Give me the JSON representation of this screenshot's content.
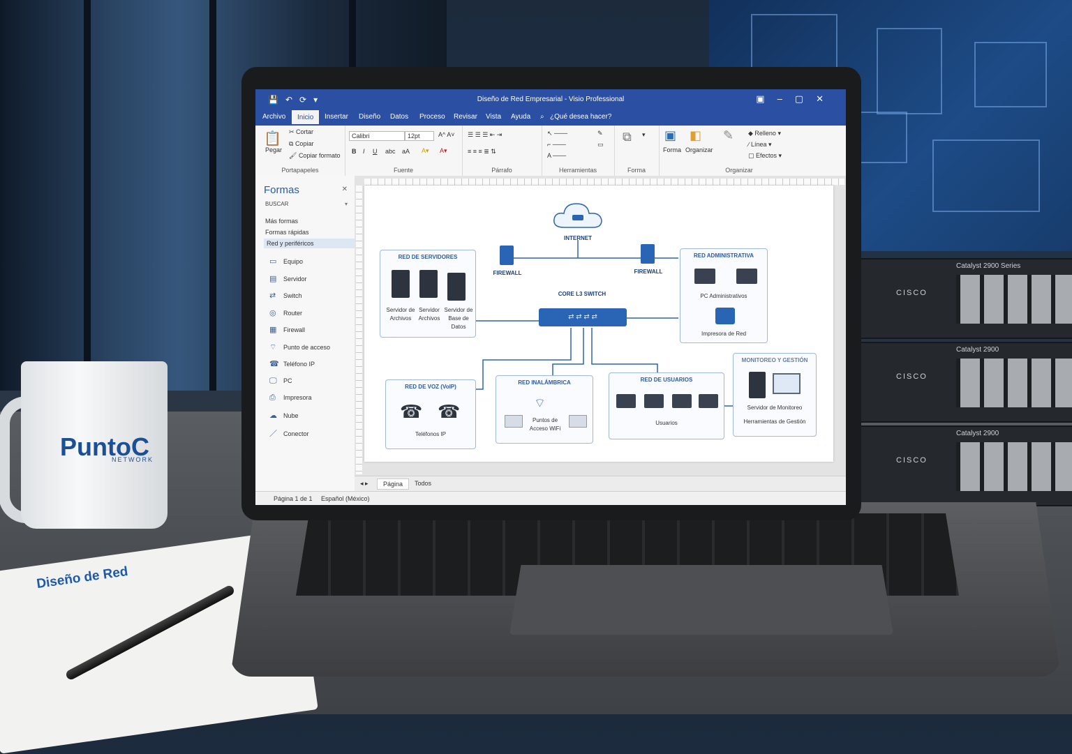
{
  "window": {
    "title": "Diseño de Red Empresarial - Visio Professional",
    "quick_access": [
      "💾",
      "↶",
      "⟳",
      "▾"
    ],
    "controls": [
      "▣",
      "–",
      "▢",
      "✕"
    ]
  },
  "tabs": [
    {
      "label": "Archivo",
      "active": false
    },
    {
      "label": "Inicio",
      "active": true
    },
    {
      "label": "Insertar",
      "active": false
    },
    {
      "label": "Diseño",
      "active": false
    },
    {
      "label": "Datos",
      "active": false
    },
    {
      "label": "Proceso",
      "active": false
    },
    {
      "label": "Revisar",
      "active": false
    },
    {
      "label": "Vista",
      "active": false
    },
    {
      "label": "Ayuda",
      "active": false
    }
  ],
  "tell_me": "¿Qué desea hacer?",
  "ribbon": {
    "clipboard": {
      "paste": "Pegar",
      "cut": "Cortar",
      "copy": "Copiar",
      "format_painter": "Copiar formato",
      "label": "Portapapeles"
    },
    "font": {
      "name": "Calibri",
      "size": "12pt",
      "label": "Fuente"
    },
    "paragraph": {
      "label": "Párrafo"
    },
    "tools": {
      "label": "Herramientas"
    },
    "shape": {
      "label": "Forma"
    },
    "arrange": {
      "shape_btn": "Forma",
      "organize": "Organizar",
      "label": "Organizar",
      "fill": "Relleno",
      "line": "Línea",
      "effects": "Efectos"
    }
  },
  "shapes_panel": {
    "title": "Formas",
    "search": "BUSCAR",
    "links": [
      "Más formas",
      "Formas rápidas",
      "Red y periféricos"
    ],
    "items": [
      {
        "icon": "▭",
        "label": "Equipo"
      },
      {
        "icon": "▤",
        "label": "Servidor"
      },
      {
        "icon": "⇄",
        "label": "Switch"
      },
      {
        "icon": "◎",
        "label": "Router"
      },
      {
        "icon": "▦",
        "label": "Firewall"
      },
      {
        "icon": "⌔",
        "label": "Punto de acceso"
      },
      {
        "icon": "☎",
        "label": "Teléfono IP"
      },
      {
        "icon": "🖵",
        "label": "PC"
      },
      {
        "icon": "⎙",
        "label": "Impresora"
      },
      {
        "icon": "☁",
        "label": "Nube"
      },
      {
        "icon": "／",
        "label": "Conector"
      }
    ]
  },
  "diagram": {
    "internet": "INTERNET",
    "firewall_left": "FIREWALL",
    "firewall_right": "FIREWALL",
    "core": "CORE L3 SWITCH",
    "servers": {
      "title": "RED DE SERVIDORES",
      "labels": [
        "Servidor de Archivos",
        "Servidor Archivos",
        "Servidor de Base de Datos"
      ]
    },
    "admin": {
      "title": "RED ADMINISTRATIVA",
      "pcs": "PC Administrativos",
      "printer": "Impresora de Red"
    },
    "voip": {
      "title": "RED DE VOZ (VoIP)",
      "phones": "Teléfonos IP"
    },
    "wireless": {
      "title": "RED INALÁMBRICA",
      "ap": "Puntos de Acceso WiFi"
    },
    "users": {
      "title": "RED DE USUARIOS",
      "label": "Usuarios"
    },
    "monitor": {
      "title": "MONITOREO Y GESTIÓN",
      "server": "Servidor de Monitoreo",
      "tools": "Herramientas de Gestión"
    }
  },
  "sheet_tabs": [
    "Página",
    "Todos"
  ],
  "status": {
    "page": "Página 1 de 1",
    "language": "Español (México)"
  },
  "scene": {
    "mug_brand": "PuntoC",
    "mug_sub": "NETWORK",
    "notebook": "Diseño de Red",
    "switch_models": [
      "Catalyst 2900 Series",
      "Catalyst 2900",
      "Catalyst 2900"
    ],
    "switch_brand": "CISCO"
  },
  "colors": {
    "accent": "#2b4fa2",
    "diagram_blue": "#2a64b4"
  }
}
